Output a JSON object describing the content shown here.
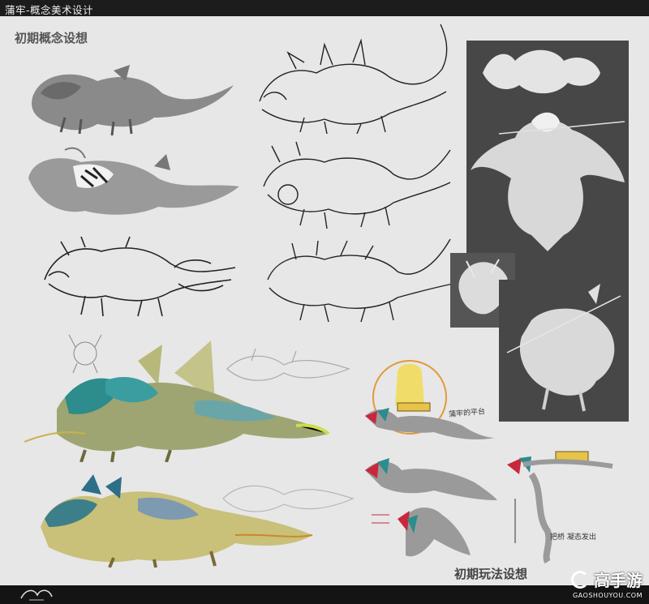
{
  "header": {
    "title": "蒲牢-概念美术设计"
  },
  "sections": {
    "early_concept": "初期概念设想",
    "early_gameplay": "初期玩法设想"
  },
  "branding": {
    "name": "高手游",
    "url": "GAOSHOUYOU.COM"
  },
  "colors": {
    "background": "#e7e7e7",
    "header_bar": "#1c1c1c",
    "render_panel": "#474747",
    "accent_red": "#c8283c",
    "accent_teal": "#2d8c8c",
    "accent_yellow": "#e8c24a"
  },
  "annotations": {
    "note_1": "蒲牢的平台",
    "note_2": "把桥 凝态发出"
  }
}
